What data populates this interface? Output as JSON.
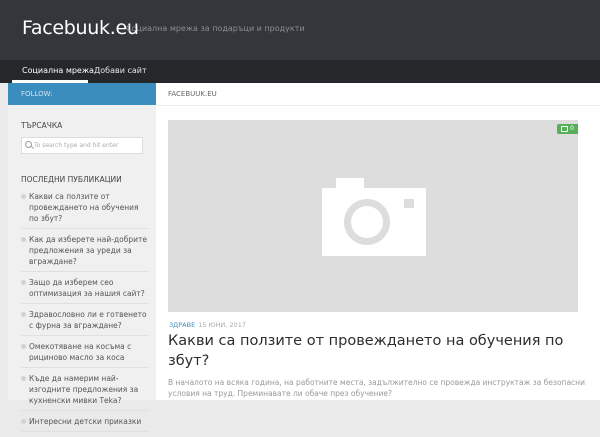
{
  "header": {
    "site_title": "Facebuuk.eu",
    "tagline": "Социална мрежа за подаръци и продукти"
  },
  "nav": {
    "items": [
      {
        "label": "Социална мрежа"
      },
      {
        "label": "Добави сайт"
      }
    ]
  },
  "sidebar": {
    "follow_label": "FOLLOW:",
    "search_heading": "ТЪРСАЧКА",
    "search_placeholder": "To search type and hit enter",
    "recent_heading": "ПОСЛЕДНИ ПУБЛИКАЦИИ",
    "posts": [
      "Какви са ползите от провеждането на обучения по збут?",
      "Как да изберете най-добрите предложения за уреди за вграждане?",
      "Защо да изберем сео оптимизация за нашия сайт?",
      "Здравословно ли е готвенето с фурна за вграждане?",
      "Омекотяване на косъма с рициново масло за коса",
      "Къде да намерим най-изгодните предложения за кухненски мивки Теka?",
      "Интересни детски приказки"
    ]
  },
  "content": {
    "breadcrumb": "FACEBUUK.EU",
    "comment_count": "0",
    "category": "ЗДРАВЕ",
    "date": "15 ЮНИ, 2017",
    "title": "Какви са ползите от провеждането на обучения по збут?",
    "excerpt": "В началото на всяка година, на работните места, задължително се провежда инструктаж за безопасни условия на труд. Преминавате ли обаче през обучение?"
  }
}
